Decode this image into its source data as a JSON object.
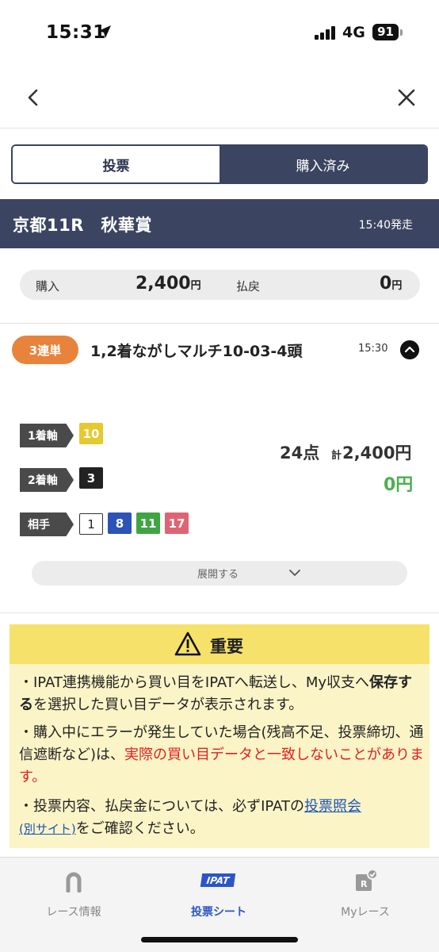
{
  "status": {
    "time": "15:31",
    "network": "4G",
    "battery": "91"
  },
  "segments": {
    "vote": "投票",
    "purchased": "購入済み"
  },
  "race": {
    "title": "京都11R　秋華賞",
    "post_time": "15:40発走"
  },
  "summary": {
    "purchase_label": "購入",
    "purchase_value": "2,400",
    "purchase_unit": "円",
    "refund_label": "払戻",
    "refund_value": "0",
    "refund_unit": "円"
  },
  "bet": {
    "type": "3連単",
    "description": "1,2着ながしマルチ10-03-4頭",
    "time": "15:30",
    "first_axis_label": "1着軸",
    "first_axis": [
      "10"
    ],
    "second_axis_label": "2着軸",
    "second_axis": [
      "3"
    ],
    "partners_label": "相手",
    "partners": [
      "1",
      "8",
      "11",
      "17"
    ],
    "points": "24点",
    "total_prefix": "計",
    "total": "2,400円",
    "payout": "0円",
    "expand_label": "展開する"
  },
  "notice": {
    "title": "重要",
    "p1_a": "・IPAT連携機能から買い目をIPATへ転送し、My収支へ",
    "p1_bold": "保存する",
    "p1_b": "を選択した買い目データが表示されます。",
    "p2_a": "・購入中にエラーが発生していた場合(残高不足、投票締切、通信遮断など)は、",
    "p2_red": "実際の買い目データと一致しないことがあります。",
    "p3_a": "・投票内容、払戻金については、必ずIPATの",
    "p3_link": "投票照会",
    "p3_link2": "(別サイト)",
    "p3_b": "をご確認ください。"
  },
  "tabs": {
    "race_info": "レース情報",
    "ipat_badge": "IPAT",
    "vote_sheet": "投票シート",
    "my_race": "Myレース"
  },
  "colors": {
    "navy": "#3b4460",
    "orange": "#e8833c",
    "green": "#4caf50",
    "red": "#e02020",
    "blue": "#2b55c7"
  }
}
